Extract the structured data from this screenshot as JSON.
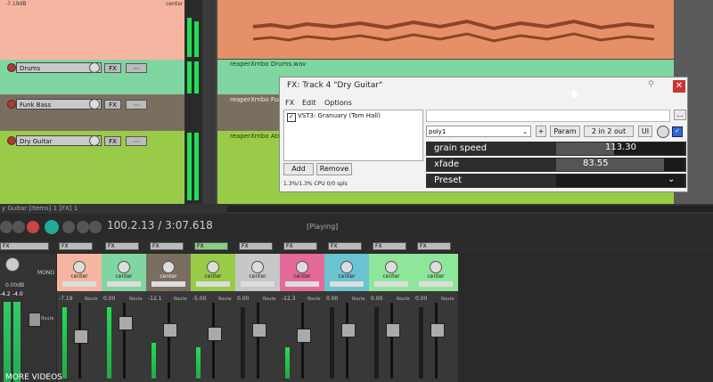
{
  "colors": {
    "orange_item": "#e59068",
    "green_track": "#7fd6a1",
    "brown_track": "#7a6e60",
    "lime_track": "#9acb48",
    "pink_track": "#e46a9a",
    "teal_track": "#6ac3d0",
    "mint_track": "#8ee69a",
    "gray_track": "#c6c8c8",
    "salmon_track": "#f6b5a1"
  },
  "top_track": {
    "db_label": "-7.19dB",
    "pan_label": "center"
  },
  "tracks": [
    {
      "name": "Drums",
      "fx_label": "FX",
      "env_label": "⋯"
    },
    {
      "name": "Funk Bass",
      "fx_label": "FX",
      "env_label": "⋯"
    },
    {
      "name": "Dry Guitar",
      "fx_label": "FX",
      "env_label": "⋯"
    }
  ],
  "items": [
    {
      "label": "reaperXrnbo Drums.wav"
    },
    {
      "label": "reaperXrnbo Funk"
    },
    {
      "label": "reaperXrnbo Atm"
    }
  ],
  "fx_window": {
    "title": "FX: Track 4 \"Dry Guitar\"",
    "menu": [
      "FX",
      "Edit",
      "Options"
    ],
    "plugin": "VST3: Granuary (Tom Hall)",
    "add_label": "Add",
    "remove_label": "Remove",
    "cpu_label": "1.3%/1.3% CPU 0/0 spls",
    "preset_select": "poly1",
    "plus_label": "+",
    "param_label": "Param",
    "io_label": "2 in 2 out",
    "ui_label": "UI",
    "more_label": "...",
    "params": [
      {
        "name": "grain speed",
        "value": "113.30",
        "fraction": 0.45
      },
      {
        "name": "xfade",
        "value": "83.55",
        "fraction": 0.84
      },
      {
        "name": "Preset",
        "value": ""
      }
    ]
  },
  "status_bar": {
    "text": "y Guitar [Items] 1 [FX] 1"
  },
  "transport": {
    "position": "100.2.13 / 3:07.618",
    "state": "[Playing]"
  },
  "mixer": {
    "master_label": "MONO",
    "master_db": "0.00dB",
    "master_peaks": [
      "-4.2",
      "-4.0"
    ],
    "strip_fx_label": "FX",
    "strips": [
      {
        "pan": "center",
        "db": "-7.19"
      },
      {
        "pan": "center",
        "db": "0.00"
      },
      {
        "pan": "center",
        "db": "-12.1"
      },
      {
        "pan": "center",
        "db": "-5.00"
      },
      {
        "pan": "center",
        "db": "0.00"
      },
      {
        "pan": "center",
        "db": "-12.3"
      },
      {
        "pan": "center",
        "db": "0.00"
      },
      {
        "pan": "center",
        "db": "0.00"
      },
      {
        "pan": "center",
        "db": "0.00"
      }
    ],
    "route_label": "Route"
  },
  "overlay": {
    "more_videos": "MORE VIDEOS"
  }
}
